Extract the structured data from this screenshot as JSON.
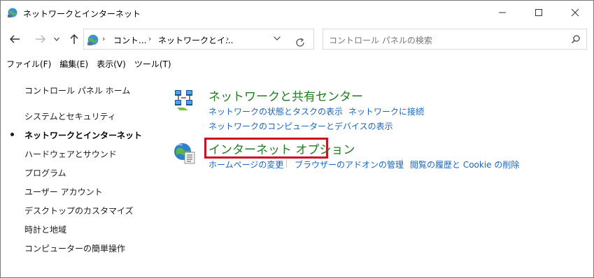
{
  "window": {
    "title": "ネットワークとインターネット",
    "minimize_icon": "minimize-icon",
    "maximize_icon": "maximize-icon",
    "close_icon": "close-icon"
  },
  "nav": {
    "breadcrumb": [
      "コント...",
      "ネットワークとイ..."
    ],
    "search_placeholder": "コントロール パネルの検索"
  },
  "menu": {
    "items": [
      "ファイル(F)",
      "編集(E)",
      "表示(V)",
      "ツール(T)"
    ]
  },
  "sidebar": {
    "items": [
      "コントロール パネル ホーム",
      "システムとセキュリティ",
      "ネットワークとインターネット",
      "ハードウェアとサウンド",
      "プログラム",
      "ユーザー アカウント",
      "デスクトップのカスタマイズ",
      "時計と地域",
      "コンピューターの簡単操作"
    ],
    "active_index": 2
  },
  "categories": [
    {
      "title": "ネットワークと共有センター",
      "icon": "network-sharing-center-icon",
      "tasks": [
        "ネットワークの状態とタスクの表示",
        "ネットワークに接続",
        "ネットワークのコンピューターとデバイスの表示"
      ]
    },
    {
      "title": "インターネット オプション",
      "icon": "internet-options-icon",
      "tasks": [
        "ホームページの変更",
        "ブラウザーのアドオンの管理",
        "閲覧の履歴と Cookie の削除"
      ]
    }
  ],
  "colors": {
    "category_title": "#1e7d1e",
    "link": "#1565c0",
    "highlight": "#cc1122"
  }
}
